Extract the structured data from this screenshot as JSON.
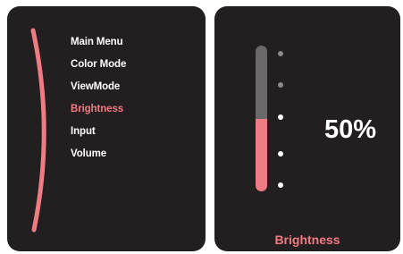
{
  "menu": {
    "items": [
      {
        "label": "Main Menu"
      },
      {
        "label": "Color Mode"
      },
      {
        "label": "ViewMode"
      },
      {
        "label": "Brightness"
      },
      {
        "label": "Input"
      },
      {
        "label": "Volume"
      }
    ],
    "selected": "Brightness"
  },
  "brightness": {
    "value_text": "50%",
    "level": 0.5,
    "caption": "Brightness"
  },
  "colors": {
    "panel_bg": "#231f20",
    "accent": "#ef7b83",
    "text": "#ffffff",
    "track": "#6a6868",
    "tick_inactive": "#8a8888"
  }
}
